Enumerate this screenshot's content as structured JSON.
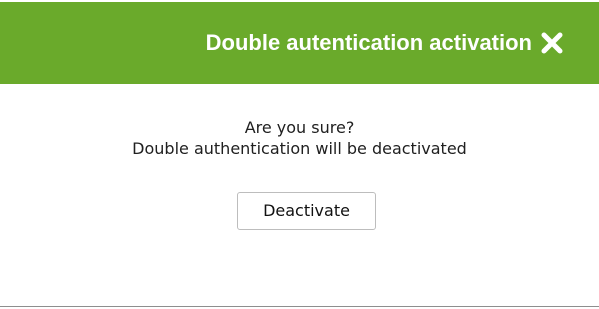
{
  "dialog": {
    "title": "Double autentication activation",
    "close_icon": "close-icon",
    "message_line1": "Are you sure?",
    "message_line2": "Double authentication will be deactivated",
    "deactivate_label": "Deactivate"
  },
  "colors": {
    "titlebar": "#6aaa2b",
    "title_text": "#ffffff",
    "body_text": "#202020",
    "button_border": "#bdbdbd"
  }
}
